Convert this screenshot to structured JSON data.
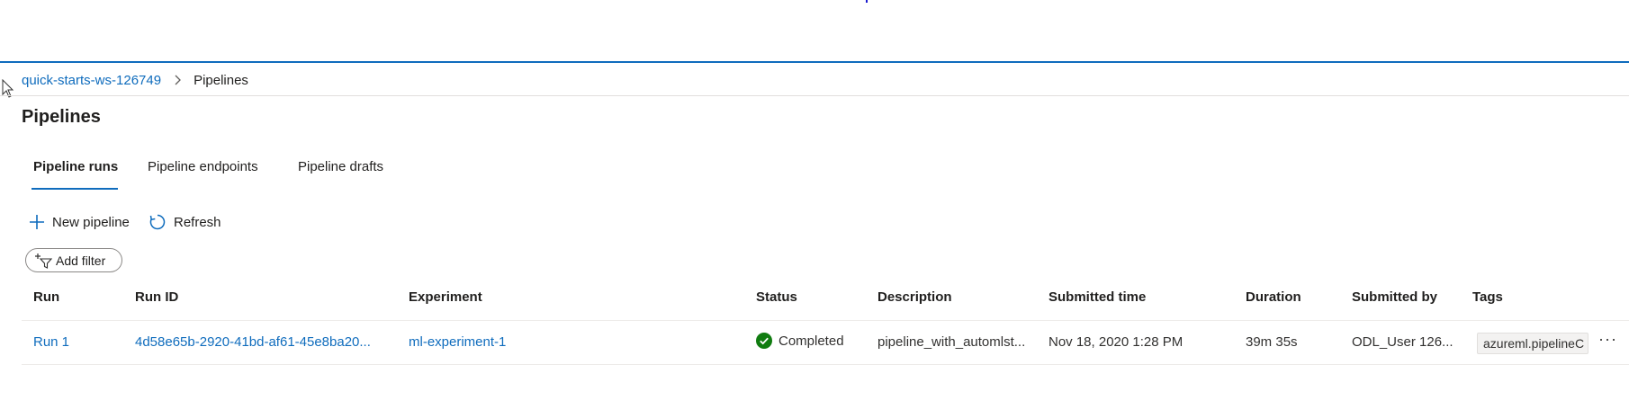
{
  "breadcrumb": {
    "workspace": "quick-starts-ws-126749",
    "current": "Pipelines"
  },
  "page": {
    "title": "Pipelines"
  },
  "tabs": [
    {
      "label": "Pipeline runs",
      "active": true
    },
    {
      "label": "Pipeline endpoints",
      "active": false
    },
    {
      "label": "Pipeline drafts",
      "active": false
    }
  ],
  "toolbar": {
    "new_label": "New pipeline",
    "refresh_label": "Refresh"
  },
  "filter": {
    "label": "Add filter"
  },
  "table": {
    "columns": [
      "Run",
      "Run ID",
      "Experiment",
      "Status",
      "Description",
      "Submitted time",
      "Duration",
      "Submitted by",
      "Tags"
    ],
    "rows": [
      {
        "run": "Run 1",
        "run_id": "4d58e65b-2920-41bd-af61-45e8ba20...",
        "experiment": "ml-experiment-1",
        "status": "Completed",
        "description": "pipeline_with_automlst...",
        "submitted_time": "Nov 18, 2020 1:28 PM",
        "duration": "39m 35s",
        "submitted_by": "ODL_User 126...",
        "tag": "azureml.pipelineC"
      }
    ]
  },
  "colors": {
    "accent": "#0f6cbd",
    "success": "#107c10",
    "text": "#201f1e"
  },
  "icons": [
    "cursor-icon",
    "chevron-right-icon",
    "plus-icon",
    "refresh-icon",
    "filter-icon",
    "check-circle-icon",
    "more-icon"
  ]
}
